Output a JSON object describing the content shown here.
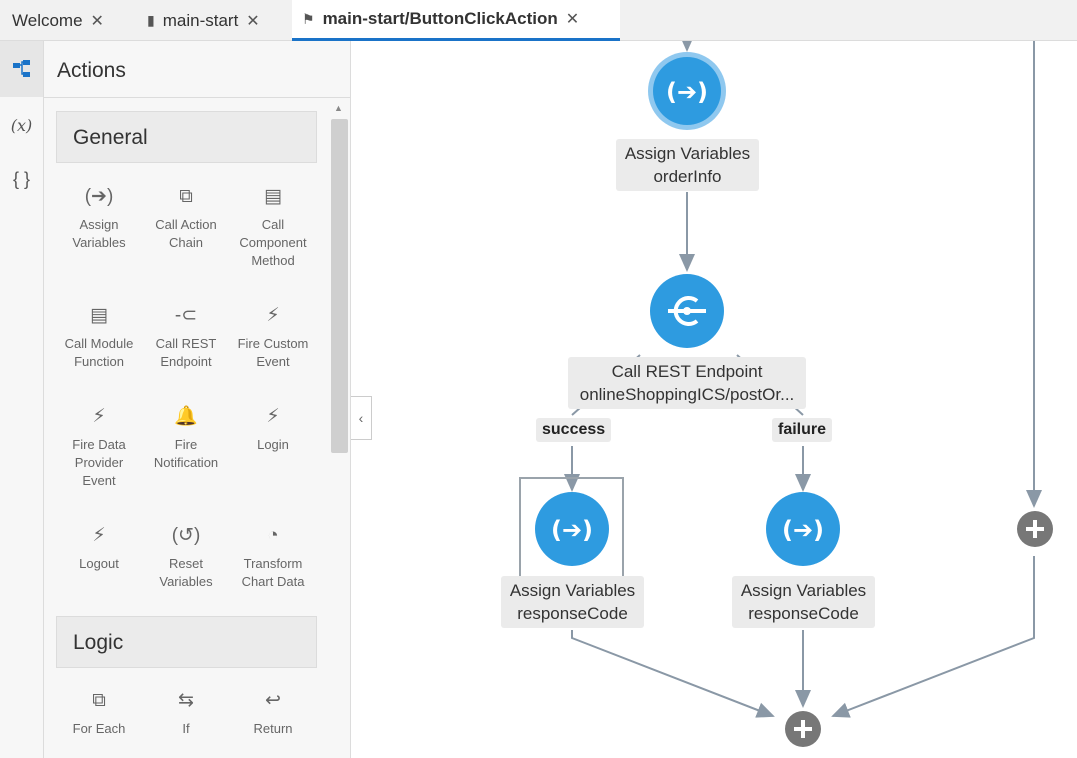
{
  "tabs": [
    {
      "label": "Welcome",
      "active": false,
      "icon": "none"
    },
    {
      "label": "main-start",
      "active": false,
      "icon": "page-icon"
    },
    {
      "label": "main-start/ButtonClickAction",
      "active": true,
      "icon": "flag-icon"
    }
  ],
  "rail": {
    "items": [
      {
        "name": "actions-rail-icon",
        "glyph": "",
        "active": true
      },
      {
        "name": "variables-rail-icon",
        "glyph": "(x)",
        "active": false
      },
      {
        "name": "json-rail-icon",
        "glyph": "{ }",
        "active": false
      }
    ]
  },
  "panel": {
    "title": "Actions",
    "sections": [
      {
        "title": "General"
      },
      {
        "title": "Logic"
      }
    ],
    "general": [
      {
        "label": "Assign\nVariables",
        "icon": "assign-icon",
        "glyph": "(➔)"
      },
      {
        "label": "Call Action\nChain",
        "icon": "action-chain-icon",
        "glyph": "⧉"
      },
      {
        "label": "Call\nComponent\nMethod",
        "icon": "component-method-icon",
        "glyph": "▤"
      },
      {
        "label": "Call Module\nFunction",
        "icon": "module-function-icon",
        "glyph": "▤"
      },
      {
        "label": "Call REST\nEndpoint",
        "icon": "rest-endpoint-icon",
        "glyph": "-⊂"
      },
      {
        "label": "Fire Custom\nEvent",
        "icon": "lightning-icon",
        "glyph": "⚡"
      },
      {
        "label": "Fire Data\nProvider\nEvent",
        "icon": "lightning-icon",
        "glyph": "⚡"
      },
      {
        "label": "Fire\nNotification",
        "icon": "bell-icon",
        "glyph": "🔔"
      },
      {
        "label": "Login",
        "icon": "lightning-icon",
        "glyph": "⚡"
      },
      {
        "label": "Logout",
        "icon": "lightning-icon",
        "glyph": "⚡"
      },
      {
        "label": "Reset\nVariables",
        "icon": "reset-icon",
        "glyph": "(↺)"
      },
      {
        "label": "Transform\nChart Data",
        "icon": "pie-chart-icon",
        "glyph": "◔"
      }
    ],
    "logic": [
      {
        "label": "For Each",
        "icon": "for-each-icon",
        "glyph": "⧉"
      },
      {
        "label": "If",
        "icon": "if-icon",
        "glyph": "⇆"
      },
      {
        "label": "Return",
        "icon": "return-icon",
        "glyph": "↩"
      }
    ]
  },
  "diagram": {
    "nodes": [
      {
        "title": "Assign Variables",
        "subtitle": "orderInfo",
        "icon": "assign-icon"
      },
      {
        "title": "Call REST Endpoint",
        "subtitle": "onlineShoppingICS/postOr...",
        "icon": "rest-endpoint-icon"
      },
      {
        "title": "Assign Variables",
        "subtitle": "responseCode",
        "icon": "assign-icon"
      },
      {
        "title": "Assign Variables",
        "subtitle": "responseCode",
        "icon": "assign-icon"
      }
    ],
    "branches": {
      "success": "success",
      "failure": "failure"
    },
    "accent_color": "#2e9be0"
  }
}
